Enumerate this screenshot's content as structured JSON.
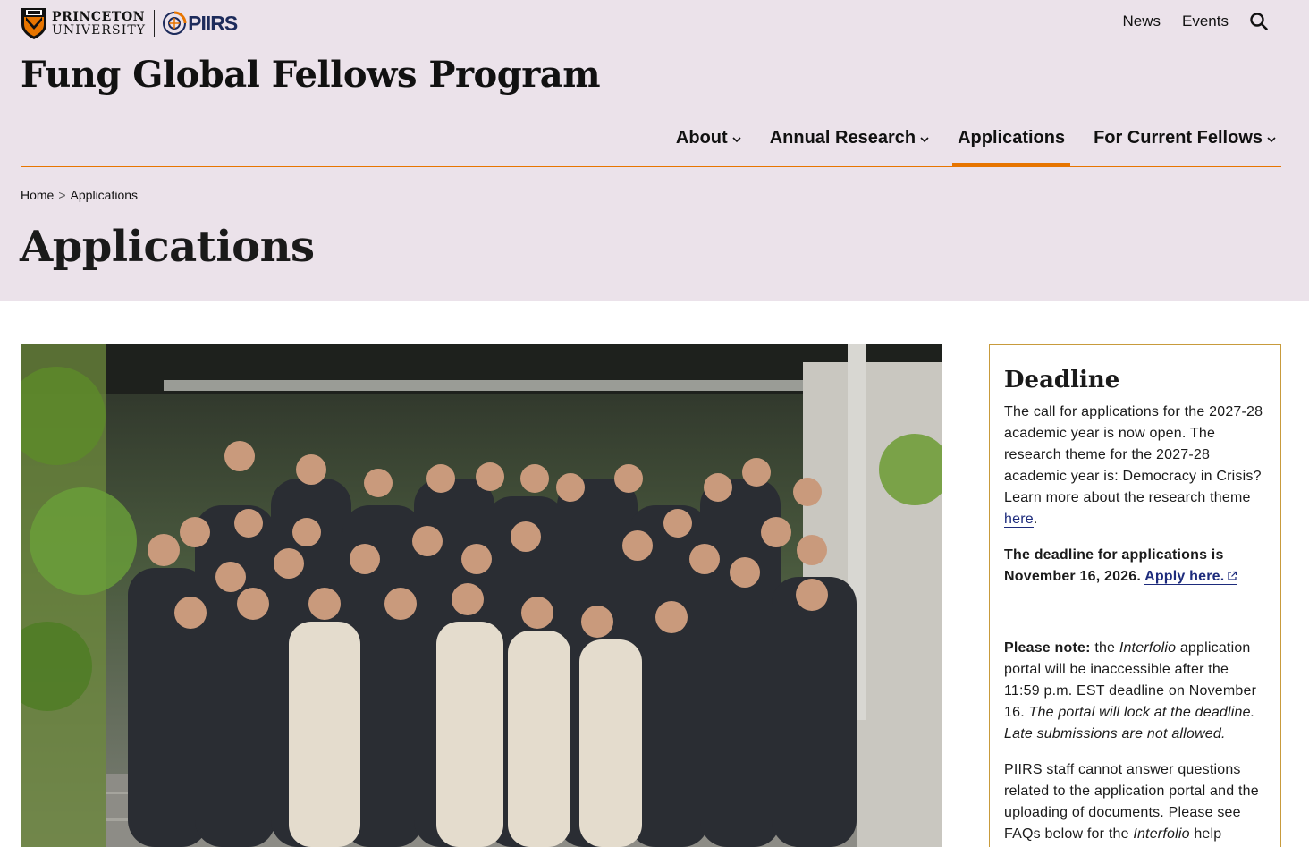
{
  "header": {
    "university_line1": "PRINCETON",
    "university_line2": "UNIVERSITY",
    "partner_logo": "PIIRS",
    "utility_links": {
      "news": "News",
      "events": "Events"
    },
    "site_title": "Fung Global Fellows Program"
  },
  "nav": {
    "about": "About",
    "annual_research": "Annual Research",
    "applications": "Applications",
    "current_fellows": "For Current Fellows"
  },
  "breadcrumb": {
    "home": "Home",
    "separator": ">",
    "current": "Applications"
  },
  "page": {
    "title": "Applications"
  },
  "sidebar": {
    "title": "Deadline",
    "p1_text": "The call for applications for the 2027-28 academic year is now open. The research theme for the 2027-28 academic year is: Democracy in Crisis? Learn more about the research theme ",
    "p1_link": "here",
    "p1_end": ".",
    "p2_text": "The deadline for applications is November 16, 2026. ",
    "p2_link": "Apply here.",
    "p3_label": "Please note:",
    "p3_text_a": " the ",
    "p3_italic_a": "Interfolio",
    "p3_text_b": " application portal will be inaccessible after the 11:59 p.m. EST deadline on November 16. ",
    "p3_italic_b": "The portal will lock at the deadline. Late submissions are not allowed.",
    "p4_text_a": "PIIRS staff cannot answer questions related to the application portal and the uploading of documents. Please see FAQs below for the ",
    "p4_italic": "Interfolio",
    "p4_text_b": " help"
  },
  "colors": {
    "accent": "#e77500",
    "hero_bg": "#ebe2ea",
    "link": "#1d2b7c",
    "box_border": "#c89b3c"
  },
  "icons": [
    "princeton-shield-icon",
    "piirs-logo-icon",
    "search-icon",
    "chevron-down-icon",
    "external-link-icon"
  ]
}
